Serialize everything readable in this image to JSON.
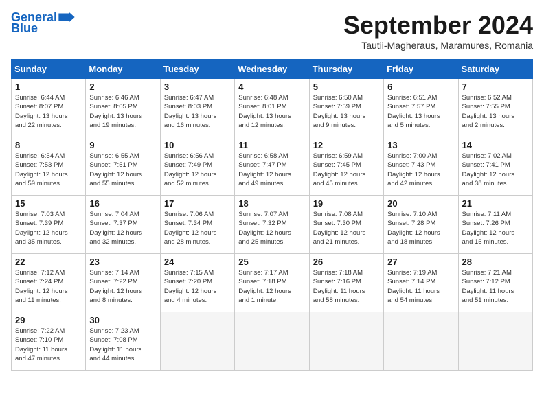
{
  "header": {
    "logo_line1": "General",
    "logo_line2": "Blue",
    "month_title": "September 2024",
    "location": "Tautii-Magheraus, Maramures, Romania"
  },
  "weekdays": [
    "Sunday",
    "Monday",
    "Tuesday",
    "Wednesday",
    "Thursday",
    "Friday",
    "Saturday"
  ],
  "weeks": [
    [
      {
        "day": "1",
        "info": "Sunrise: 6:44 AM\nSunset: 8:07 PM\nDaylight: 13 hours\nand 22 minutes."
      },
      {
        "day": "2",
        "info": "Sunrise: 6:46 AM\nSunset: 8:05 PM\nDaylight: 13 hours\nand 19 minutes."
      },
      {
        "day": "3",
        "info": "Sunrise: 6:47 AM\nSunset: 8:03 PM\nDaylight: 13 hours\nand 16 minutes."
      },
      {
        "day": "4",
        "info": "Sunrise: 6:48 AM\nSunset: 8:01 PM\nDaylight: 13 hours\nand 12 minutes."
      },
      {
        "day": "5",
        "info": "Sunrise: 6:50 AM\nSunset: 7:59 PM\nDaylight: 13 hours\nand 9 minutes."
      },
      {
        "day": "6",
        "info": "Sunrise: 6:51 AM\nSunset: 7:57 PM\nDaylight: 13 hours\nand 5 minutes."
      },
      {
        "day": "7",
        "info": "Sunrise: 6:52 AM\nSunset: 7:55 PM\nDaylight: 13 hours\nand 2 minutes."
      }
    ],
    [
      {
        "day": "8",
        "info": "Sunrise: 6:54 AM\nSunset: 7:53 PM\nDaylight: 12 hours\nand 59 minutes."
      },
      {
        "day": "9",
        "info": "Sunrise: 6:55 AM\nSunset: 7:51 PM\nDaylight: 12 hours\nand 55 minutes."
      },
      {
        "day": "10",
        "info": "Sunrise: 6:56 AM\nSunset: 7:49 PM\nDaylight: 12 hours\nand 52 minutes."
      },
      {
        "day": "11",
        "info": "Sunrise: 6:58 AM\nSunset: 7:47 PM\nDaylight: 12 hours\nand 49 minutes."
      },
      {
        "day": "12",
        "info": "Sunrise: 6:59 AM\nSunset: 7:45 PM\nDaylight: 12 hours\nand 45 minutes."
      },
      {
        "day": "13",
        "info": "Sunrise: 7:00 AM\nSunset: 7:43 PM\nDaylight: 12 hours\nand 42 minutes."
      },
      {
        "day": "14",
        "info": "Sunrise: 7:02 AM\nSunset: 7:41 PM\nDaylight: 12 hours\nand 38 minutes."
      }
    ],
    [
      {
        "day": "15",
        "info": "Sunrise: 7:03 AM\nSunset: 7:39 PM\nDaylight: 12 hours\nand 35 minutes."
      },
      {
        "day": "16",
        "info": "Sunrise: 7:04 AM\nSunset: 7:37 PM\nDaylight: 12 hours\nand 32 minutes."
      },
      {
        "day": "17",
        "info": "Sunrise: 7:06 AM\nSunset: 7:34 PM\nDaylight: 12 hours\nand 28 minutes."
      },
      {
        "day": "18",
        "info": "Sunrise: 7:07 AM\nSunset: 7:32 PM\nDaylight: 12 hours\nand 25 minutes."
      },
      {
        "day": "19",
        "info": "Sunrise: 7:08 AM\nSunset: 7:30 PM\nDaylight: 12 hours\nand 21 minutes."
      },
      {
        "day": "20",
        "info": "Sunrise: 7:10 AM\nSunset: 7:28 PM\nDaylight: 12 hours\nand 18 minutes."
      },
      {
        "day": "21",
        "info": "Sunrise: 7:11 AM\nSunset: 7:26 PM\nDaylight: 12 hours\nand 15 minutes."
      }
    ],
    [
      {
        "day": "22",
        "info": "Sunrise: 7:12 AM\nSunset: 7:24 PM\nDaylight: 12 hours\nand 11 minutes."
      },
      {
        "day": "23",
        "info": "Sunrise: 7:14 AM\nSunset: 7:22 PM\nDaylight: 12 hours\nand 8 minutes."
      },
      {
        "day": "24",
        "info": "Sunrise: 7:15 AM\nSunset: 7:20 PM\nDaylight: 12 hours\nand 4 minutes."
      },
      {
        "day": "25",
        "info": "Sunrise: 7:17 AM\nSunset: 7:18 PM\nDaylight: 12 hours\nand 1 minute."
      },
      {
        "day": "26",
        "info": "Sunrise: 7:18 AM\nSunset: 7:16 PM\nDaylight: 11 hours\nand 58 minutes."
      },
      {
        "day": "27",
        "info": "Sunrise: 7:19 AM\nSunset: 7:14 PM\nDaylight: 11 hours\nand 54 minutes."
      },
      {
        "day": "28",
        "info": "Sunrise: 7:21 AM\nSunset: 7:12 PM\nDaylight: 11 hours\nand 51 minutes."
      }
    ],
    [
      {
        "day": "29",
        "info": "Sunrise: 7:22 AM\nSunset: 7:10 PM\nDaylight: 11 hours\nand 47 minutes."
      },
      {
        "day": "30",
        "info": "Sunrise: 7:23 AM\nSunset: 7:08 PM\nDaylight: 11 hours\nand 44 minutes."
      },
      {
        "day": "",
        "info": ""
      },
      {
        "day": "",
        "info": ""
      },
      {
        "day": "",
        "info": ""
      },
      {
        "day": "",
        "info": ""
      },
      {
        "day": "",
        "info": ""
      }
    ]
  ]
}
